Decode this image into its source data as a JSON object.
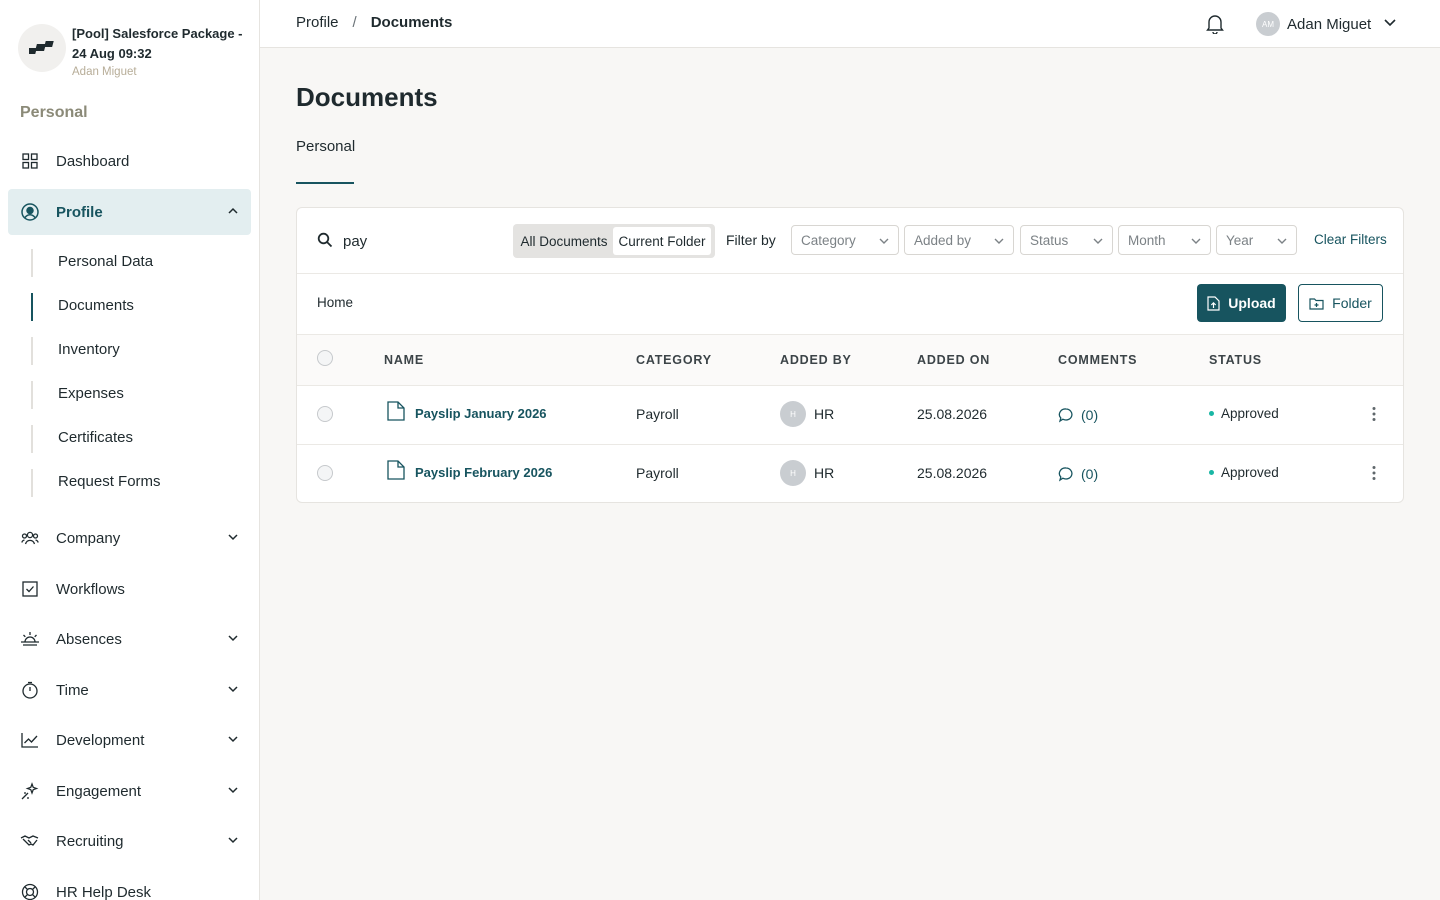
{
  "org": {
    "name": "[Pool] Salesforce Package - 24 Aug 09:32",
    "user": "Adan Miguet"
  },
  "sidebar": {
    "section_label": "Personal",
    "items": [
      {
        "label": "Dashboard",
        "icon": "grid-icon"
      },
      {
        "label": "Profile",
        "icon": "user-circle-icon"
      },
      {
        "label": "Company",
        "icon": "users-icon"
      },
      {
        "label": "Workflows",
        "icon": "checkbox-icon"
      },
      {
        "label": "Absences",
        "icon": "sunrise-icon"
      },
      {
        "label": "Time",
        "icon": "stopwatch-icon"
      },
      {
        "label": "Development",
        "icon": "chart-line-icon"
      },
      {
        "label": "Engagement",
        "icon": "sparkle-icon"
      },
      {
        "label": "Recruiting",
        "icon": "handshake-icon"
      },
      {
        "label": "HR Help Desk",
        "icon": "lifebuoy-icon"
      }
    ],
    "profile_sub": [
      {
        "label": "Personal Data"
      },
      {
        "label": "Documents"
      },
      {
        "label": "Inventory"
      },
      {
        "label": "Expenses"
      },
      {
        "label": "Certificates"
      },
      {
        "label": "Request Forms"
      }
    ]
  },
  "header": {
    "breadcrumb": [
      "Profile",
      "Documents"
    ],
    "breadcrumb_sep": "/",
    "user_initials": "AM",
    "user_name": "Adan Miguet"
  },
  "main": {
    "title": "Documents",
    "tab": "Personal",
    "toolbar": {
      "search_value": "pay",
      "seg_all": "All Documents",
      "seg_current": "Current Folder",
      "filter_label": "Filter by",
      "filters": [
        "Category",
        "Added by",
        "Status",
        "Month",
        "Year"
      ],
      "clear_label": "Clear Filters"
    },
    "folder_path": "Home",
    "upload_label": "Upload",
    "folder_label": "Folder",
    "columns": [
      "NAME",
      "CATEGORY",
      "ADDED BY",
      "ADDED ON",
      "COMMENTS",
      "STATUS"
    ],
    "rows": [
      {
        "name": "Payslip January 2026",
        "category": "Payroll",
        "added_by_initial": "H",
        "added_by": "HR",
        "added_on": "25.08.2026",
        "comments": "(0)",
        "status": "Approved"
      },
      {
        "name": "Payslip February 2026",
        "category": "Payroll",
        "added_by_initial": "H",
        "added_by": "HR",
        "added_on": "25.08.2026",
        "comments": "(0)",
        "status": "Approved"
      }
    ]
  },
  "colors": {
    "accent": "#17545f",
    "status_approved": "#19b6a4",
    "active_nav_bg": "#e3eef0"
  }
}
